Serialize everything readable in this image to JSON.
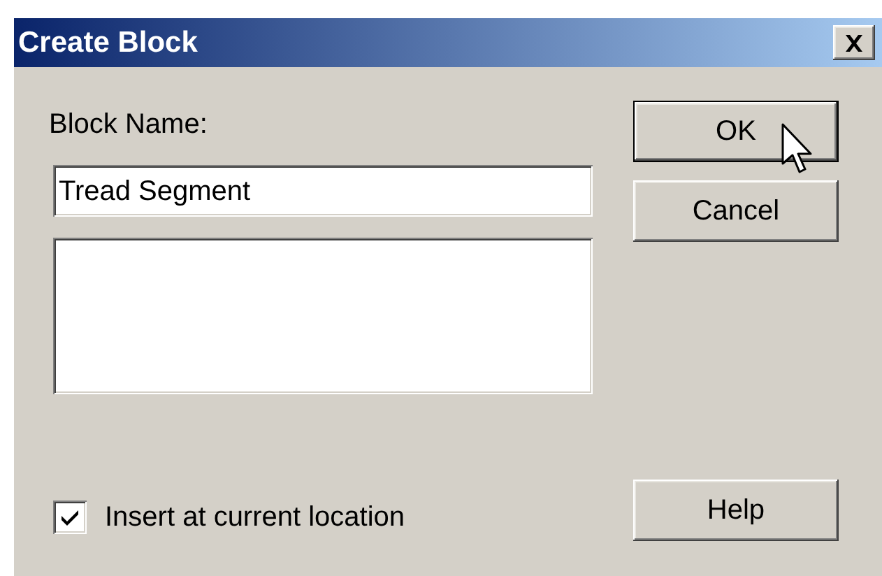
{
  "window": {
    "title": "Create Block"
  },
  "block_name": {
    "label": "Block Name:",
    "value": "Tread Segment"
  },
  "buttons": [
    {
      "label": "OK",
      "default": true
    },
    {
      "label": "Cancel",
      "default": false
    }
  ],
  "insert_at_current_location": {
    "label": "Insert at current location",
    "checked": true
  },
  "help_button": {
    "label": "Help",
    "default": false
  }
}
